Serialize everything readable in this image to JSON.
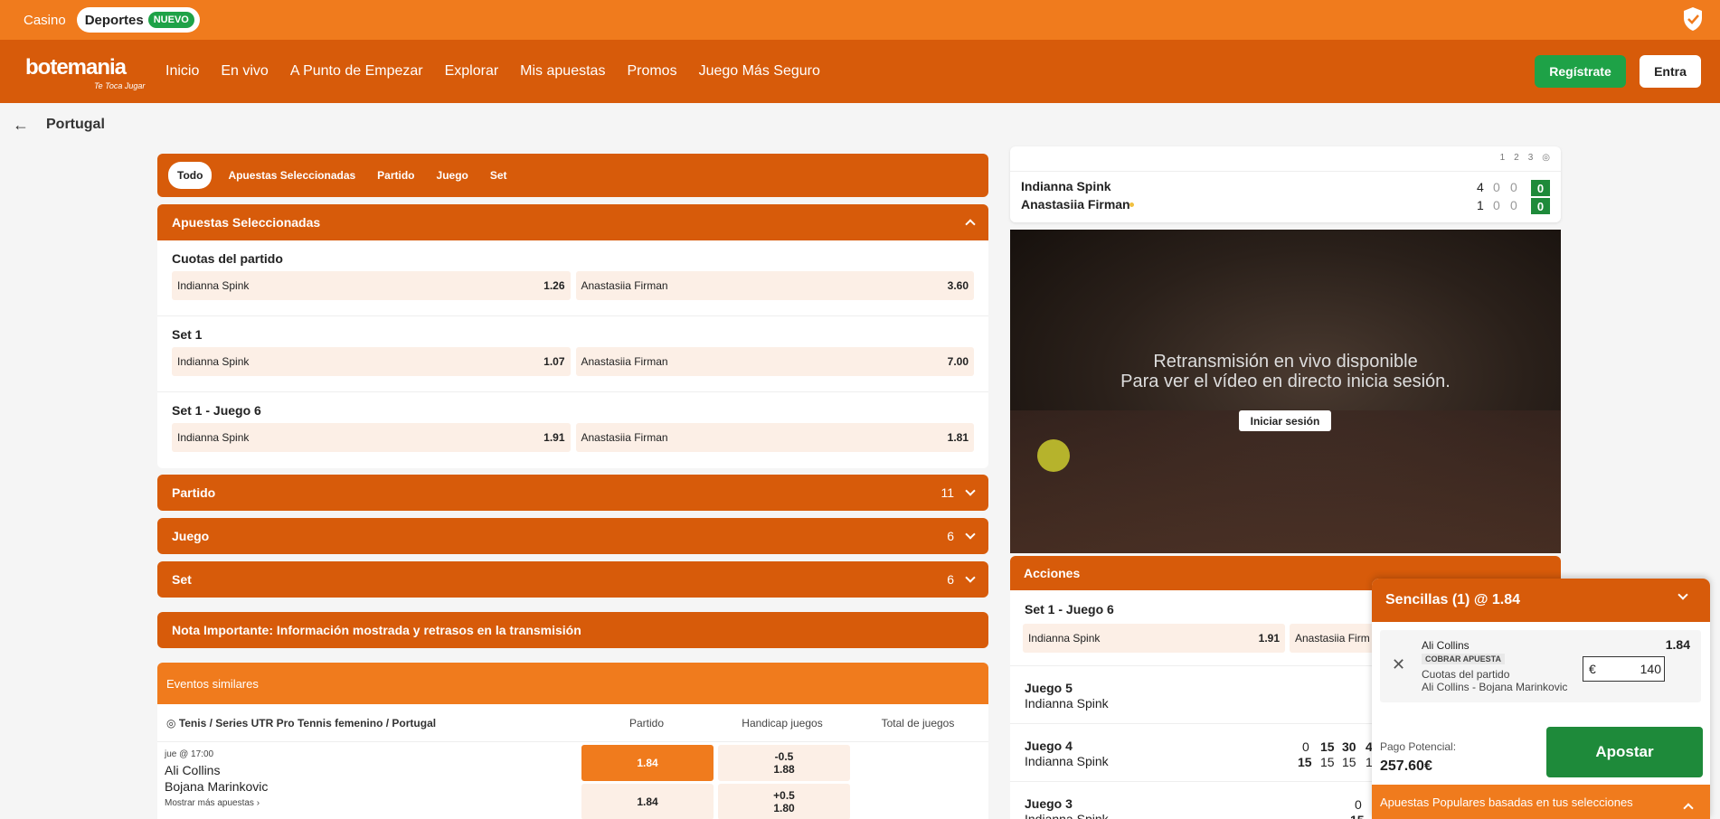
{
  "topbar": {
    "casino": "Casino",
    "deportes": "Deportes",
    "nuevo": "NUEVO"
  },
  "brand": {
    "logo": "botemania",
    "tagline": "Te Toca Jugar"
  },
  "nav": [
    "Inicio",
    "En vivo",
    "A Punto de Empezar",
    "Explorar",
    "Mis apuestas",
    "Promos",
    "Juego Más Seguro"
  ],
  "auth": {
    "register": "Regístrate",
    "login": "Entra"
  },
  "page": {
    "title": "Portugal"
  },
  "tabs": [
    "Todo",
    "Apuestas Seleccionadas",
    "Partido",
    "Juego",
    "Set"
  ],
  "selected_section": {
    "title": "Apuestas Seleccionadas",
    "markets": [
      {
        "title": "Cuotas del partido",
        "p1": "Indianna Spink",
        "o1": "1.26",
        "p2": "Anastasiia Firman",
        "o2": "3.60"
      },
      {
        "title": "Set 1",
        "p1": "Indianna Spink",
        "o1": "1.07",
        "p2": "Anastasiia Firman",
        "o2": "7.00"
      },
      {
        "title": "Set 1 - Juego 6",
        "p1": "Indianna Spink",
        "o1": "1.91",
        "p2": "Anastasiia Firman",
        "o2": "1.81"
      }
    ]
  },
  "sections": [
    {
      "title": "Partido",
      "count": "11"
    },
    {
      "title": "Juego",
      "count": "6"
    },
    {
      "title": "Set",
      "count": "6"
    }
  ],
  "nota": "Nota Importante: Información mostrada y retrasos en la transmisión",
  "similar": {
    "title": "Eventos similares",
    "crumb": "Tenis / Series UTR Pro Tennis femenino / Portugal",
    "cols": [
      "Partido",
      "Handicap juegos",
      "Total de juegos"
    ],
    "event": {
      "time": "jue @ 17:00",
      "p1": "Ali Collins",
      "p2": "Bojana Marinkovic",
      "more": "Mostrar más apuestas ›",
      "m1": "1.84",
      "m2": "1.84",
      "h1_line": "-0.5",
      "h1_odd": "1.88",
      "h2_line": "+0.5",
      "h2_odd": "1.80"
    }
  },
  "scoreboard": {
    "headers": [
      "1",
      "2",
      "3"
    ],
    "p1": {
      "name": "Indianna Spink",
      "sets": [
        "4",
        "0",
        "0"
      ],
      "points": "0"
    },
    "p2": {
      "name": "Anastasiia Firman",
      "sets": [
        "1",
        "0",
        "0"
      ],
      "points": "0"
    }
  },
  "stream": {
    "line1": "Retransmisión en vivo disponible",
    "line2": "Para ver el vídeo en directo inicia sesión.",
    "button": "Iniciar sesión"
  },
  "actions": {
    "title": "Acciones",
    "market": {
      "title": "Set 1 - Juego 6",
      "p1": "Indianna Spink",
      "o1": "1.91",
      "p2": "Anastasiia Firm"
    },
    "juego5": {
      "title": "Juego 5",
      "sub": "Indianna Spink"
    },
    "juego4": {
      "title": "Juego 4",
      "sub": "Indianna Spink",
      "top": [
        "0",
        "15",
        "30",
        "4"
      ],
      "bottom": [
        "15",
        "15",
        "15",
        "1"
      ]
    },
    "juego3": {
      "title": "Juego 3",
      "sub": "Indianna Spink",
      "top": [
        "0"
      ],
      "bottom": [
        "15"
      ]
    }
  },
  "betslip": {
    "title": "Sencillas (1) @ 1.84",
    "selection": "Ali Collins",
    "cashout": "COBRAR APUESTA",
    "market": "Cuotas del partido",
    "event": "Ali Collins - Bojana Marinkovic",
    "odds": "1.84",
    "currency": "€",
    "stake": "140",
    "payout_label": "Pago Potencial:",
    "payout": "257.60€",
    "bet_button": "Apostar",
    "popular": "Apuestas Populares basadas en tus selecciones"
  },
  "colors": {
    "orange": "#f07b1d",
    "dark_orange": "#d75b0a",
    "green": "#1ea247"
  }
}
